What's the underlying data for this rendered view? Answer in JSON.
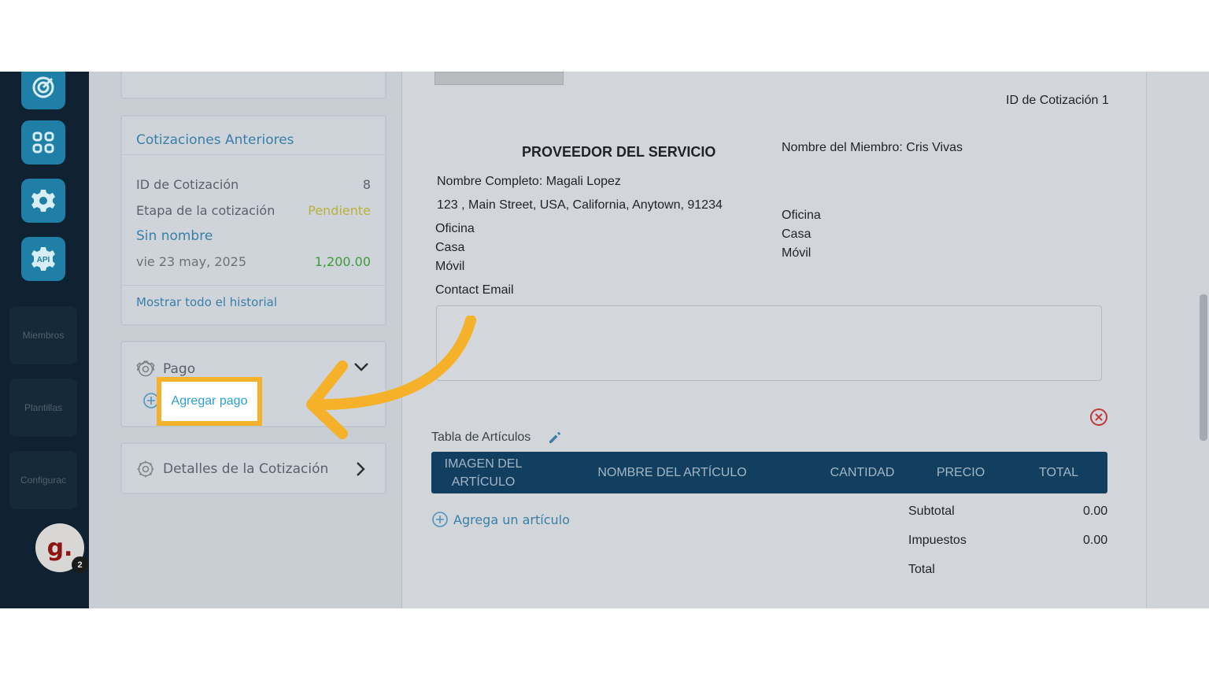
{
  "sidebar": {
    "icons": [
      "target-icon",
      "grid-icon",
      "gear-icon",
      "api-icon"
    ],
    "api_label": "API",
    "items": [
      {
        "label": "Miembros"
      },
      {
        "label": "Plantillas"
      },
      {
        "label": "Configurac"
      }
    ],
    "avatar_letter": "g.",
    "notification_count": "2"
  },
  "previous_quotes": {
    "title": "Cotizaciones Anteriores",
    "id_label": "ID de Cotización",
    "id_value": "8",
    "stage_label": "Etapa de la cotización",
    "stage_value": "Pendiente",
    "name": "Sin nombre",
    "date": "vie 23 may, 2025",
    "amount": "1,200.00",
    "history_link": "Mostrar todo el historial"
  },
  "payment": {
    "title": "Pago",
    "add_payment": "Agregar pago"
  },
  "quote_details": {
    "title": "Detalles de la Cotización"
  },
  "quote": {
    "id_label": "ID de Cotización 1",
    "provider_heading": "PROVEEDOR DEL SERVICIO",
    "member_name": "Nombre del Miembro: Cris Vivas",
    "full_name": "Nombre Completo:  Magali Lopez",
    "address": "123 , Main Street, USA, California, Anytown, 91234",
    "provider_phones": [
      "Oficina",
      "Casa",
      "Móvil"
    ],
    "member_phones": [
      "Oficina",
      "Casa",
      "Móvil"
    ],
    "contact_email_label": "Contact Email",
    "items_table_label": "Tabla de Artículos",
    "columns": [
      "IMAGEN DEL ARTÍCULO",
      "NOMBRE DEL ARTÍCULO",
      "CANTIDAD",
      "PRECIO",
      "TOTAL"
    ],
    "add_item": "Agrega un artículo",
    "subtotal_label": "Subtotal",
    "subtotal_value": "0.00",
    "tax_label": "Impuestos",
    "tax_value": "0.00",
    "total_label": "Total"
  },
  "colors": {
    "accent_blue": "#3a7fa8",
    "pending": "#b9b13a",
    "amount_green": "#3f9a3a",
    "table_header": "#123f5f",
    "highlight": "#f6b12a"
  }
}
